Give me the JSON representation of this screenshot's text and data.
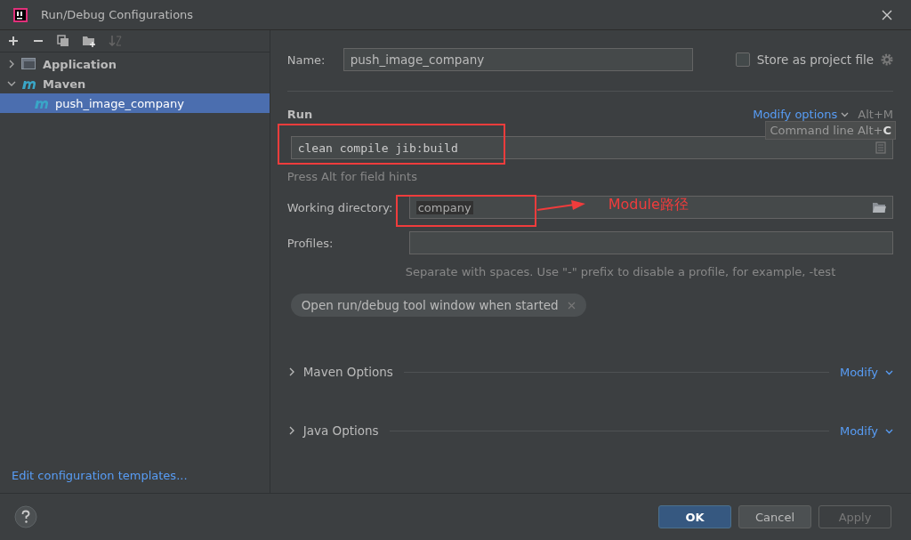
{
  "window": {
    "title": "Run/Debug Configurations"
  },
  "tree": [
    {
      "label": "Application",
      "kind": "application",
      "expanded": false,
      "selected": false
    },
    {
      "label": "Maven",
      "kind": "maven",
      "expanded": true,
      "selected": false,
      "children": [
        {
          "label": "push_image_company",
          "kind": "maven",
          "selected": true
        }
      ]
    }
  ],
  "edit_templates_link": "Edit configuration templates...",
  "name_field": {
    "label": "Name:",
    "value": "push_image_company"
  },
  "store_as_project_file": {
    "label": "Store as project file",
    "checked": false
  },
  "run_section": {
    "title": "Run",
    "modify_link": "Modify options",
    "shortcut": "Alt+M",
    "tooltip": "Command line Alt+**C**",
    "command": "clean compile jib:build",
    "hint": "Press Alt for field hints"
  },
  "working_directory": {
    "label": "Working directory:",
    "value": "company"
  },
  "profiles": {
    "label": "Profiles:",
    "hint": "Separate with spaces. Use \"-\" prefix to disable a profile, for example, -test"
  },
  "chips": [
    "Open run/debug tool window when started"
  ],
  "sections": [
    {
      "label": "Maven Options",
      "expanded": false,
      "action": "Modify"
    },
    {
      "label": "Java Options",
      "expanded": false,
      "action": "Modify"
    }
  ],
  "annotation": {
    "text": "Module路径"
  },
  "buttons": [
    {
      "label": "OK",
      "kind": "default"
    },
    {
      "label": "Cancel",
      "kind": "normal"
    },
    {
      "label": "Apply",
      "kind": "disabled"
    }
  ]
}
